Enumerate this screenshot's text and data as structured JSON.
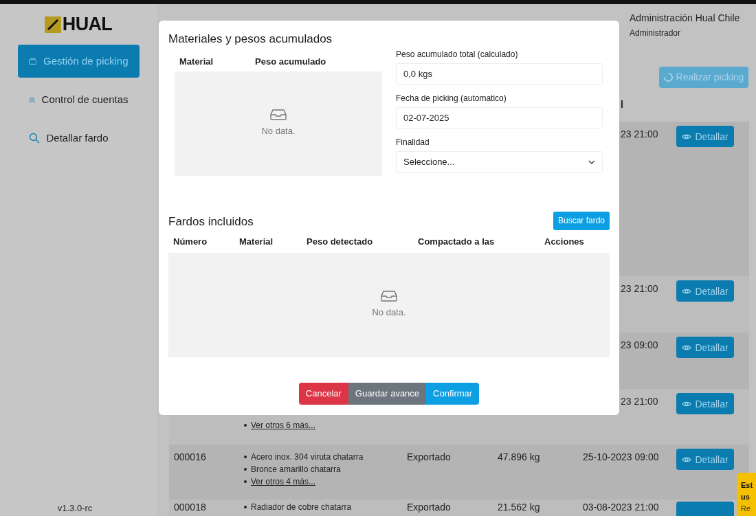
{
  "sidebar": {
    "logo": "HUAL",
    "items": [
      {
        "label": "Gestión de picking",
        "selected": true
      },
      {
        "label": "Control de cuentas",
        "selected": false
      },
      {
        "label": "Detallar fardo",
        "selected": false
      }
    ],
    "version": "v1.3.0-rc"
  },
  "user": {
    "name": "Administración Hual Chile",
    "role": "Administrador"
  },
  "action_button": {
    "label": "Realizar picking",
    "loading": true
  },
  "table": {
    "column_6": "l",
    "rows": [
      {
        "date": "23 21:00",
        "button": "Detallar"
      },
      {
        "date": "23 21:00",
        "button": "Detallar"
      },
      {
        "date": "23 09:00",
        "button": "Detallar"
      },
      {
        "date": "23 21:00",
        "button": "Detallar",
        "more": "Ver otros 6 más..."
      },
      {
        "number": "000016",
        "materials": [
          "Acero inox. 304 viruta chatarra",
          "Bronce amarillo chatarra"
        ],
        "more": "Ver otros 4 más...",
        "purpose": "Exportado",
        "weight": "47.896 kg",
        "date": "25-10-2023 09:00",
        "button": "Detallar"
      },
      {
        "number": "000018",
        "materials": [
          "Radiador de cobre chatarra"
        ],
        "purpose": "Exportado",
        "weight": "21.562 kg",
        "date": "03-08-2023 21:00"
      }
    ]
  },
  "modal": {
    "materials": {
      "title": "Materiales y pesos acumulados",
      "columns": [
        "Material",
        "Peso acumulado"
      ],
      "empty": "No data."
    },
    "fields": [
      {
        "label": "Peso acumulado total (calculado)",
        "value": "0,0 kgs",
        "kind": "input"
      },
      {
        "label": "Fecha de picking (automatico)",
        "value": "02-07-2025",
        "kind": "input"
      },
      {
        "label": "Finalidad",
        "placeholder": "Seleccione...",
        "kind": "select"
      }
    ],
    "bales": {
      "title": "Fardos incluidos",
      "search_button": "Buscar fardo",
      "columns": [
        "Número",
        "Material",
        "Peso detectado",
        "Compactado a las",
        "Acciones"
      ],
      "empty": "No data."
    },
    "buttons": [
      {
        "label": "Cancelar",
        "kind": "danger"
      },
      {
        "label": "Guardar avance",
        "kind": "secondary"
      },
      {
        "label": "Confirmar",
        "kind": "primary"
      }
    ]
  },
  "toast": {
    "lines": [
      "Est",
      "us",
      "Re"
    ]
  }
}
